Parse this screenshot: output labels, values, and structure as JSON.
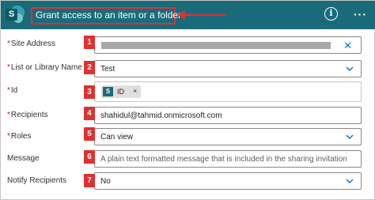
{
  "header": {
    "title": "Grant access to an item or a folder",
    "logo_letter": "S",
    "info_icon": "i",
    "more_icon": "···",
    "background": "#1a6b7a"
  },
  "fields": [
    {
      "label": "Site Address",
      "required": true,
      "value": "",
      "control": "clear",
      "number": "1"
    },
    {
      "label": "List or Library Name",
      "required": true,
      "value": "Test",
      "control": "dropdown",
      "number": "2"
    },
    {
      "label": "Id",
      "required": true,
      "token": {
        "label": "ID",
        "remove": "×"
      },
      "number": "3"
    },
    {
      "label": "Recipients",
      "required": true,
      "value": "shahidul@tahmid.onmicrosoft.com",
      "number": "4"
    },
    {
      "label": "Roles",
      "required": true,
      "value": "Can view",
      "control": "dropdown",
      "number": "5"
    },
    {
      "label": "Message",
      "required": false,
      "placeholder": "A plain text formatted message that is included in the sharing invitation",
      "number": "6"
    },
    {
      "label": "Notify Recipients",
      "required": false,
      "value": "No",
      "control": "dropdown",
      "number": "7"
    }
  ],
  "annotation_color": "#e03030"
}
